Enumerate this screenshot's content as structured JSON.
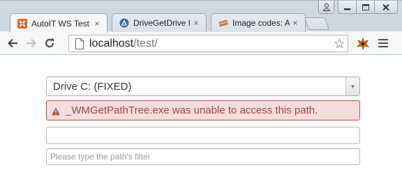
{
  "browser": {
    "tabs": [
      {
        "title": "AutoIT WS Test",
        "icon": "autoit-icon",
        "active": true
      },
      {
        "title": "DriveGetDrive Is",
        "icon": "autoit-forum-icon",
        "active": false
      },
      {
        "title": "Image codes: Au",
        "icon": "books-icon",
        "active": false
      }
    ],
    "close_glyph": "×",
    "address": {
      "host": "localhost",
      "path": "/test/"
    },
    "controls": {
      "user": "user-icon",
      "minimize": "minimize-icon",
      "maximize": "maximize-icon",
      "close": "close-icon"
    }
  },
  "page": {
    "drive_select": {
      "value": "Drive C: (FIXED)"
    },
    "error": {
      "message": "_WMGetPathTree.exe was unable to access this path.",
      "icon": "warning-icon"
    },
    "path_input": {
      "value": ""
    },
    "filter_input": {
      "placeholder": "Please type the path's filter",
      "value": ""
    }
  },
  "colors": {
    "error_bg": "#f2dede",
    "error_border": "#b94a48",
    "error_text": "#a94442",
    "autoit_orange": "#f05a22"
  }
}
